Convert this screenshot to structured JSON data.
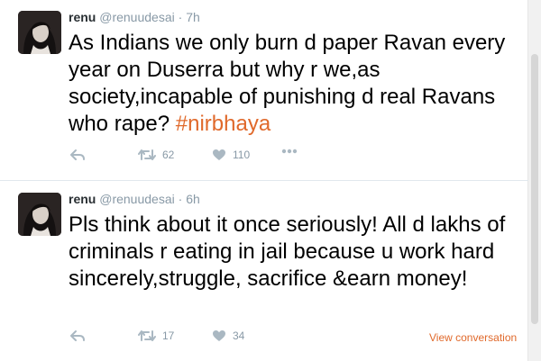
{
  "tweets": [
    {
      "name": "renu",
      "handle": "@renuudesai",
      "separator": "·",
      "time": "7h",
      "text": "As Indians we only burn d paper Ravan every year on Duserra but why r we,as society,incapable of punishing d real Ravans who rape? ",
      "hashtag": "#nirbhaya",
      "retweets": "62",
      "likes": "110"
    },
    {
      "name": "renu",
      "handle": "@renuudesai",
      "separator": "·",
      "time": "6h",
      "text": "Pls think about it once seriously! All d lakhs of criminals r eating in jail because u work hard sincerely,struggle, sacrifice &earn money!",
      "hashtag": "",
      "retweets": "17",
      "likes": "34",
      "view_conversation": "View conversation"
    }
  ],
  "colors": {
    "accent": "#e0692b",
    "meta": "#8899a6",
    "icon": "#aab8c2",
    "divider": "#e1e8ed"
  },
  "icons": [
    "reply-icon",
    "retweet-icon",
    "like-icon",
    "more-icon"
  ]
}
